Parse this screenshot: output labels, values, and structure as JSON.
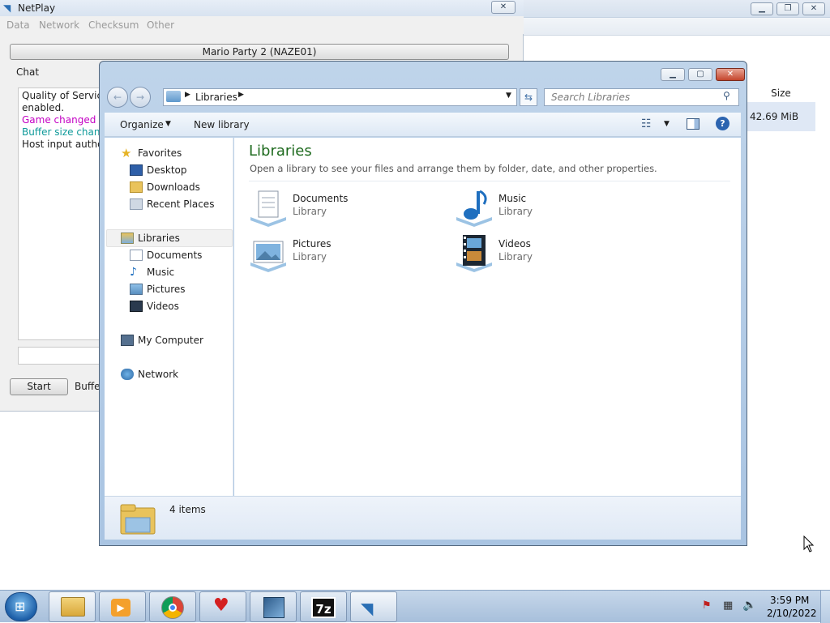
{
  "netplay": {
    "title": "NetPlay",
    "menu": [
      "Data",
      "Network",
      "Checksum",
      "Other"
    ],
    "game_button": "Mario Party 2 (NAZE01)",
    "chat_label": "Chat",
    "chat_lines": [
      {
        "text": "Quality of Service",
        "color": "#1e1e1e"
      },
      {
        "text": "enabled.",
        "color": "#1e1e1e"
      },
      {
        "text": "Game changed to",
        "color": "#c400c4"
      },
      {
        "text": "Buffer size change",
        "color": "#0f9a9a"
      },
      {
        "text": "Host input authori",
        "color": "#1e1e1e"
      }
    ],
    "start_button": "Start",
    "buffer_label": "Buffe"
  },
  "bg_window": {
    "size_header": "Size",
    "size_value": "42.69 MiB"
  },
  "explorer": {
    "breadcrumb": "Libraries",
    "search_placeholder": "Search Libraries",
    "organize": "Organize",
    "new_library": "New library",
    "nav": {
      "favorites": "Favorites",
      "favorites_items": [
        "Desktop",
        "Downloads",
        "Recent Places"
      ],
      "libraries": "Libraries",
      "libraries_items": [
        "Documents",
        "Music",
        "Pictures",
        "Videos"
      ],
      "computer": "My Computer",
      "network": "Network"
    },
    "heading": "Libraries",
    "description": "Open a library to see your files and arrange them by folder, date, and other properties.",
    "libraries": [
      {
        "name": "Documents",
        "type": "Library"
      },
      {
        "name": "Music",
        "type": "Library"
      },
      {
        "name": "Pictures",
        "type": "Library"
      },
      {
        "name": "Videos",
        "type": "Library"
      }
    ],
    "status": "4 items"
  },
  "taskbar": {
    "time": "3:59 PM",
    "date": "2/10/2022",
    "apps": [
      "explorer-icon",
      "media-player-icon",
      "chrome-icon",
      "heart-app-icon",
      "virtualbox-icon",
      "7zip-icon",
      "dolphin-icon"
    ]
  },
  "colors": {
    "heading": "#1e6a1e",
    "accent": "#3b6ea5"
  }
}
